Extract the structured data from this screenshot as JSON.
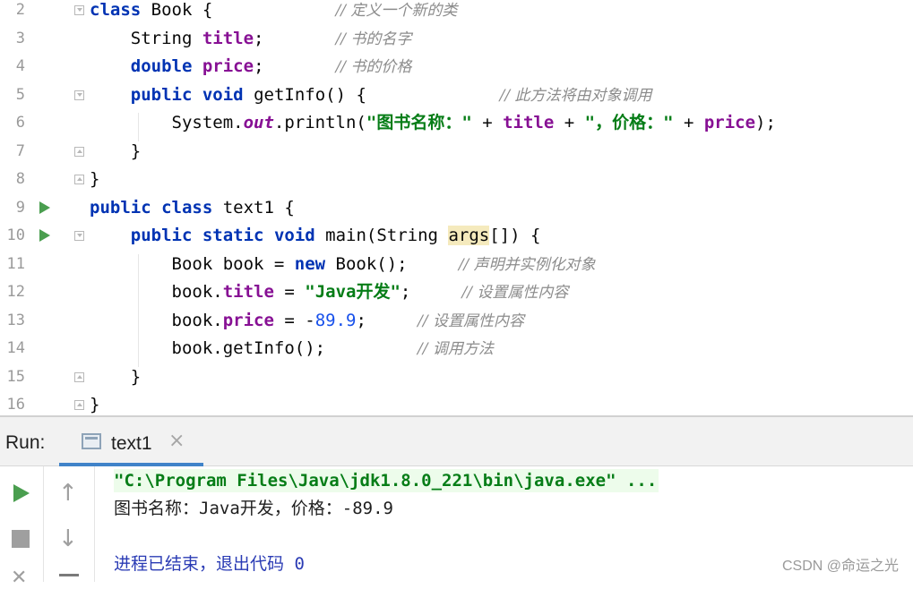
{
  "editor": {
    "lines": [
      {
        "num": "2",
        "segs": [
          [
            "kw",
            "class"
          ],
          [
            "",
            "&nbsp;Book {"
          ],
          [
            "",
            "            "
          ],
          [
            "cmt",
            "// 定义一个新的类"
          ]
        ]
      },
      {
        "num": "3",
        "segs": [
          [
            "",
            "    String "
          ],
          [
            "fld",
            "title"
          ],
          [
            "",
            ";       "
          ],
          [
            "cmt",
            "// 书的名字"
          ]
        ]
      },
      {
        "num": "4",
        "segs": [
          [
            "",
            "    "
          ],
          [
            "kw",
            "double"
          ],
          [
            "",
            " "
          ],
          [
            "fld",
            "price"
          ],
          [
            "",
            ";       "
          ],
          [
            "cmt",
            "// 书的价格"
          ]
        ]
      },
      {
        "num": "5",
        "segs": [
          [
            "",
            "    "
          ],
          [
            "kw",
            "public"
          ],
          [
            "",
            " "
          ],
          [
            "kw",
            "void"
          ],
          [
            "",
            " getInfo() {             "
          ],
          [
            "cmt",
            "// 此方法将由对象调用"
          ]
        ]
      },
      {
        "num": "6",
        "segs": [
          [
            "",
            "        System."
          ],
          [
            "static-fld",
            "out"
          ],
          [
            "",
            ".println("
          ],
          [
            "str",
            "\"图书名称：\""
          ],
          [
            "",
            " + "
          ],
          [
            "fld",
            "title"
          ],
          [
            "",
            " + "
          ],
          [
            "str",
            "\"，价格：\""
          ],
          [
            "",
            " + "
          ],
          [
            "fld",
            "price"
          ],
          [
            "",
            ");"
          ]
        ]
      },
      {
        "num": "7",
        "segs": [
          [
            "",
            "    }"
          ]
        ]
      },
      {
        "num": "8",
        "segs": [
          [
            "",
            "}"
          ]
        ]
      },
      {
        "num": "9",
        "segs": [
          [
            "kw",
            "public"
          ],
          [
            "",
            " "
          ],
          [
            "kw",
            "class"
          ],
          [
            "",
            " text1 {"
          ]
        ]
      },
      {
        "num": "10",
        "segs": [
          [
            "",
            "    "
          ],
          [
            "kw",
            "public"
          ],
          [
            "",
            " "
          ],
          [
            "kw",
            "static"
          ],
          [
            "",
            " "
          ],
          [
            "kw",
            "void"
          ],
          [
            "",
            " main(String "
          ],
          [
            "hl",
            "args"
          ],
          [
            "",
            "[]) {"
          ]
        ]
      },
      {
        "num": "11",
        "segs": [
          [
            "",
            "        Book book = "
          ],
          [
            "kw",
            "new"
          ],
          [
            "",
            " Book();     "
          ],
          [
            "cmt",
            "// 声明并实例化对象"
          ]
        ]
      },
      {
        "num": "12",
        "segs": [
          [
            "",
            "        book."
          ],
          [
            "fld",
            "title"
          ],
          [
            "",
            " = "
          ],
          [
            "str",
            "\"Java开发\""
          ],
          [
            "",
            ";     "
          ],
          [
            "cmt",
            "// 设置属性内容"
          ]
        ]
      },
      {
        "num": "13",
        "segs": [
          [
            "",
            "        book."
          ],
          [
            "fld",
            "price"
          ],
          [
            "",
            " = -"
          ],
          [
            "num",
            "89.9"
          ],
          [
            "",
            ";     "
          ],
          [
            "cmt",
            "// 设置属性内容"
          ]
        ]
      },
      {
        "num": "14",
        "segs": [
          [
            "",
            "        book.getInfo();         "
          ],
          [
            "cmt",
            "// 调用方法"
          ]
        ]
      },
      {
        "num": "15",
        "segs": [
          [
            "",
            "    }"
          ]
        ]
      },
      {
        "num": "16",
        "segs": [
          [
            "",
            "}"
          ]
        ]
      }
    ]
  },
  "run_panel": {
    "label": "Run:",
    "tab_title": "text1",
    "tab_close": "×",
    "console": {
      "command": "\"C:\\Program Files\\Java\\jdk1.8.0_221\\bin\\java.exe\" ...",
      "output": "图书名称：Java开发，价格：-89.9",
      "exit": "进程已结束，退出代码 0"
    }
  },
  "icons": {
    "rerun": "play-icon",
    "stop": "stop-icon",
    "close": "close-icon",
    "up": "arrow-up-icon",
    "down": "arrow-down-icon",
    "wrap": "soft-wrap-icon"
  },
  "watermark": "CSDN @命运之光",
  "colors": {
    "keyword": "#0033b3",
    "field": "#871094",
    "string": "#067d17",
    "number": "#1750eb",
    "comment": "#8c8c8c",
    "run_green": "#4a9e4f",
    "tab_accent": "#4083c9"
  }
}
